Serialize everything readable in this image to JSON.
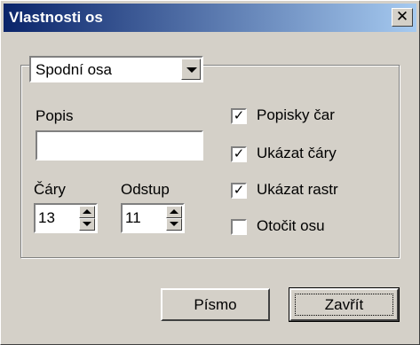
{
  "window": {
    "title": "Vlastnosti os",
    "close_label": "✕"
  },
  "axis_select": {
    "value": "Spodní osa"
  },
  "description": {
    "label": "Popis",
    "value": ""
  },
  "lines": {
    "label": "Čáry",
    "value": "13"
  },
  "offset": {
    "label": "Odstup",
    "value": "11"
  },
  "checkboxes": [
    {
      "label": "Popisky čar",
      "checked": true
    },
    {
      "label": "Ukázat čáry",
      "checked": true
    },
    {
      "label": "Ukázat rastr",
      "checked": true
    },
    {
      "label": "Otočit osu",
      "checked": false
    }
  ],
  "buttons": {
    "font": "Písmo",
    "close": "Zavřít"
  }
}
